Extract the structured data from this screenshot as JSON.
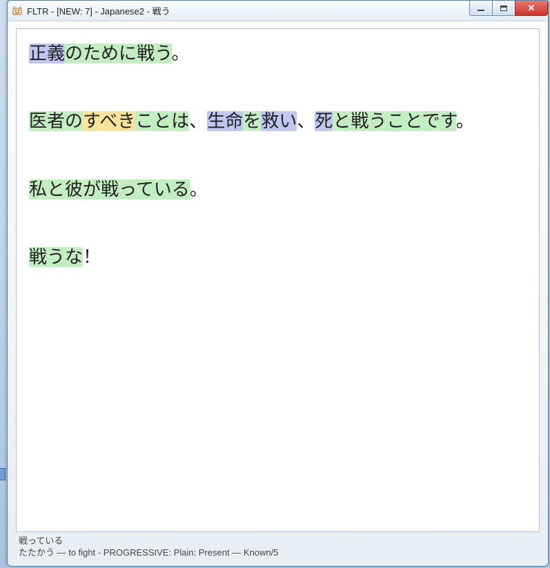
{
  "window": {
    "title": "FLTR - [NEW: 7] - Japanese2 - 戦う"
  },
  "colors": {
    "green": "#c2eec2",
    "blue": "#c0c7f0",
    "yellow": "#f7e49a"
  },
  "sentences": [
    {
      "tokens": [
        {
          "text": "正義",
          "hl": "blue"
        },
        {
          "text": "の",
          "hl": "green"
        },
        {
          "text": "ため",
          "hl": "green"
        },
        {
          "text": "に",
          "hl": "green"
        },
        {
          "text": "戦う",
          "hl": "green"
        },
        {
          "text": "。",
          "hl": "none"
        }
      ]
    },
    {
      "tokens": [
        {
          "text": "医者",
          "hl": "green"
        },
        {
          "text": "の",
          "hl": "green"
        },
        {
          "text": "す",
          "hl": "yellow"
        },
        {
          "text": "べき",
          "hl": "yellow"
        },
        {
          "text": "こと",
          "hl": "green"
        },
        {
          "text": "は",
          "hl": "green"
        },
        {
          "text": "、",
          "hl": "none"
        },
        {
          "text": "生命",
          "hl": "blue"
        },
        {
          "text": "を",
          "hl": "green"
        },
        {
          "text": "救い",
          "hl": "blue"
        },
        {
          "text": "、",
          "hl": "none"
        },
        {
          "text": "死",
          "hl": "blue"
        },
        {
          "text": "と",
          "hl": "green"
        },
        {
          "text": "戦う",
          "hl": "green"
        },
        {
          "text": "こと",
          "hl": "green"
        },
        {
          "text": "です",
          "hl": "green"
        },
        {
          "text": "。",
          "hl": "none"
        }
      ]
    },
    {
      "tokens": [
        {
          "text": "私",
          "hl": "green"
        },
        {
          "text": "と",
          "hl": "green"
        },
        {
          "text": "彼",
          "hl": "green"
        },
        {
          "text": "が",
          "hl": "green"
        },
        {
          "text": "戦っている",
          "hl": "green"
        },
        {
          "text": "。",
          "hl": "none"
        }
      ]
    },
    {
      "tokens": [
        {
          "text": "戦う",
          "hl": "green"
        },
        {
          "text": "な",
          "hl": "green"
        },
        {
          "text": "！",
          "hl": "none"
        }
      ]
    }
  ],
  "status": {
    "line1": "戦っている",
    "line2": "たたかう — to fight - PROGRESSIVE: Plain: Present — Known/5"
  }
}
